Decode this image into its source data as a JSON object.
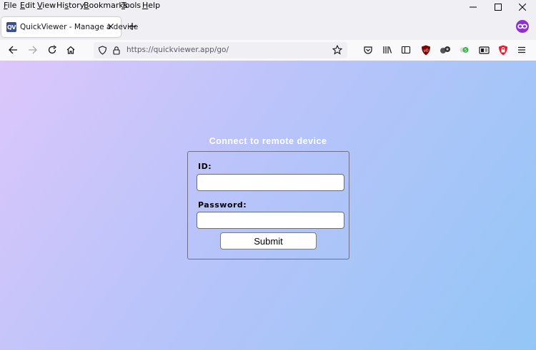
{
  "menubar": {
    "items": [
      {
        "acc": "F",
        "rest": "ile"
      },
      {
        "acc": "E",
        "rest": "dit"
      },
      {
        "acc": "V",
        "rest": "iew"
      },
      {
        "pre": "Hi",
        "acc": "s",
        "rest": "tory"
      },
      {
        "acc": "B",
        "rest": "ookmarks"
      },
      {
        "acc": "T",
        "rest": "ools"
      },
      {
        "acc": "H",
        "rest": "elp"
      }
    ]
  },
  "window_controls": [
    "minimize-icon",
    "maximize-icon",
    "close-icon"
  ],
  "tab": {
    "favicon_text": "QV",
    "title": "QuickViewer - Manage a device",
    "favicon_color": "#3a4f8c"
  },
  "navbar": {
    "url": "https://quickviewer.app/go/"
  },
  "toolbar_icons": [
    "pocket-icon",
    "library-icon",
    "sidebar-icon",
    "ublock-icon",
    "extension-icon",
    "extension-green-icon",
    "reader-icon",
    "shield-extension-icon",
    "menu-icon"
  ],
  "page": {
    "title": "Connect to remote device",
    "id_label": "ID:",
    "id_value": "",
    "password_label": "Password:",
    "password_value": "",
    "submit_label": "Submit",
    "gradient_colors": [
      "#dcc6fb",
      "#b8c4fa",
      "#93c6f6"
    ]
  }
}
